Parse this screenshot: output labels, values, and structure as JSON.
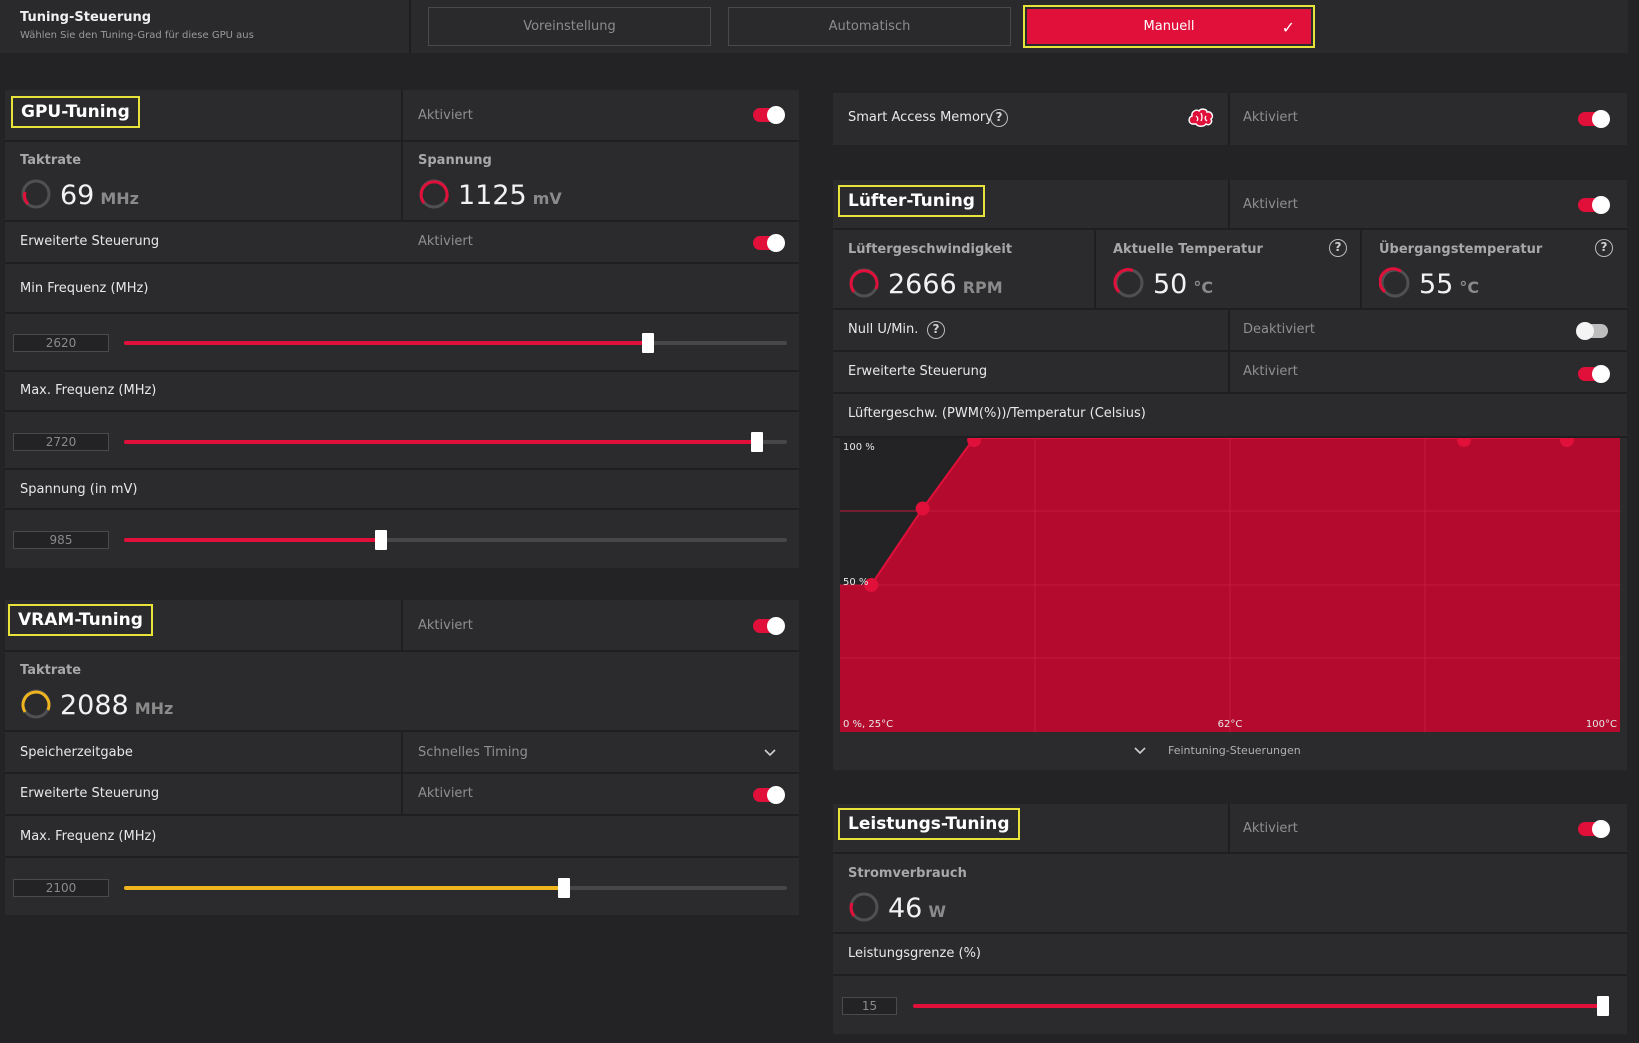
{
  "top": {
    "title": "Tuning-Steuerung",
    "subtitle": "Wählen Sie den Tuning-Grad für diese GPU aus",
    "modes": [
      "Voreinstellung",
      "Automatisch",
      "Manuell"
    ],
    "active_mode": "Manuell"
  },
  "gpu": {
    "title": "GPU-Tuning",
    "status": "Aktiviert",
    "clock_label": "Taktrate",
    "clock_value": "69",
    "clock_unit": "MHz",
    "voltage_label": "Spannung",
    "voltage_value": "1125",
    "voltage_unit": "mV",
    "adv_label": "Erweiterte Steuerung",
    "adv_status": "Aktiviert",
    "min_label": "Min Frequenz (MHz)",
    "min_value": "2620",
    "min_fill": 0.79,
    "max_label": "Max. Frequenz (MHz)",
    "max_value": "2720",
    "max_fill": 0.955,
    "volt_slider_label": "Spannung (in mV)",
    "volt_slider_value": "985",
    "volt_slider_fill": 0.388
  },
  "vram": {
    "title": "VRAM-Tuning",
    "status": "Aktiviert",
    "clock_label": "Taktrate",
    "clock_value": "2088",
    "clock_unit": "MHz",
    "timing_label": "Speicherzeitgabe",
    "timing_value": "Schnelles Timing",
    "adv_label": "Erweiterte Steuerung",
    "adv_status": "Aktiviert",
    "max_label": "Max. Frequenz (MHz)",
    "max_value": "2100",
    "max_fill": 0.663,
    "accent": "#f0b51e"
  },
  "sam": {
    "label": "Smart Access Memory",
    "status": "Aktiviert"
  },
  "fan": {
    "title": "Lüfter-Tuning",
    "status": "Aktiviert",
    "speed_label": "Lüftergeschwindigkeit",
    "speed_value": "2666",
    "speed_unit": "RPM",
    "temp_label": "Aktuelle Temperatur",
    "temp_value": "50",
    "temp_unit": "°C",
    "junction_label": "Übergangstemperatur",
    "junction_value": "55",
    "junction_unit": "°C",
    "zero_label": "Null U/Min.",
    "zero_status": "Deaktiviert",
    "adv_label": "Erweiterte Steuerung",
    "adv_status": "Aktiviert",
    "curve_label": "Lüftergeschw. (PWM(%))/Temperatur (Celsius)",
    "fine_label": "Feintuning-Steuerungen"
  },
  "fan_curve": {
    "y_top_label": "100 %",
    "y_mid_label": "50 %",
    "x_left_label": "0 %, 25°C",
    "x_mid_label": "62°C",
    "x_right_label": "100°C",
    "points": [
      [
        0.04,
        0.5
      ],
      [
        0.106,
        0.76
      ],
      [
        0.172,
        1.0
      ],
      [
        0.8,
        1.0
      ],
      [
        0.932,
        1.0
      ]
    ]
  },
  "power": {
    "title": "Leistungs-Tuning",
    "status": "Aktiviert",
    "consumption_label": "Stromverbrauch",
    "consumption_value": "46",
    "consumption_unit": "W",
    "limit_label": "Leistungsgrenze (%)",
    "limit_value": "15",
    "limit_fill": 1.0
  },
  "colors": {
    "accent": "#e0103a",
    "highlight": "#e8e33a",
    "chart_fill": "#b30a2e"
  },
  "icons": {
    "mode_check": "✓",
    "help": "?"
  }
}
